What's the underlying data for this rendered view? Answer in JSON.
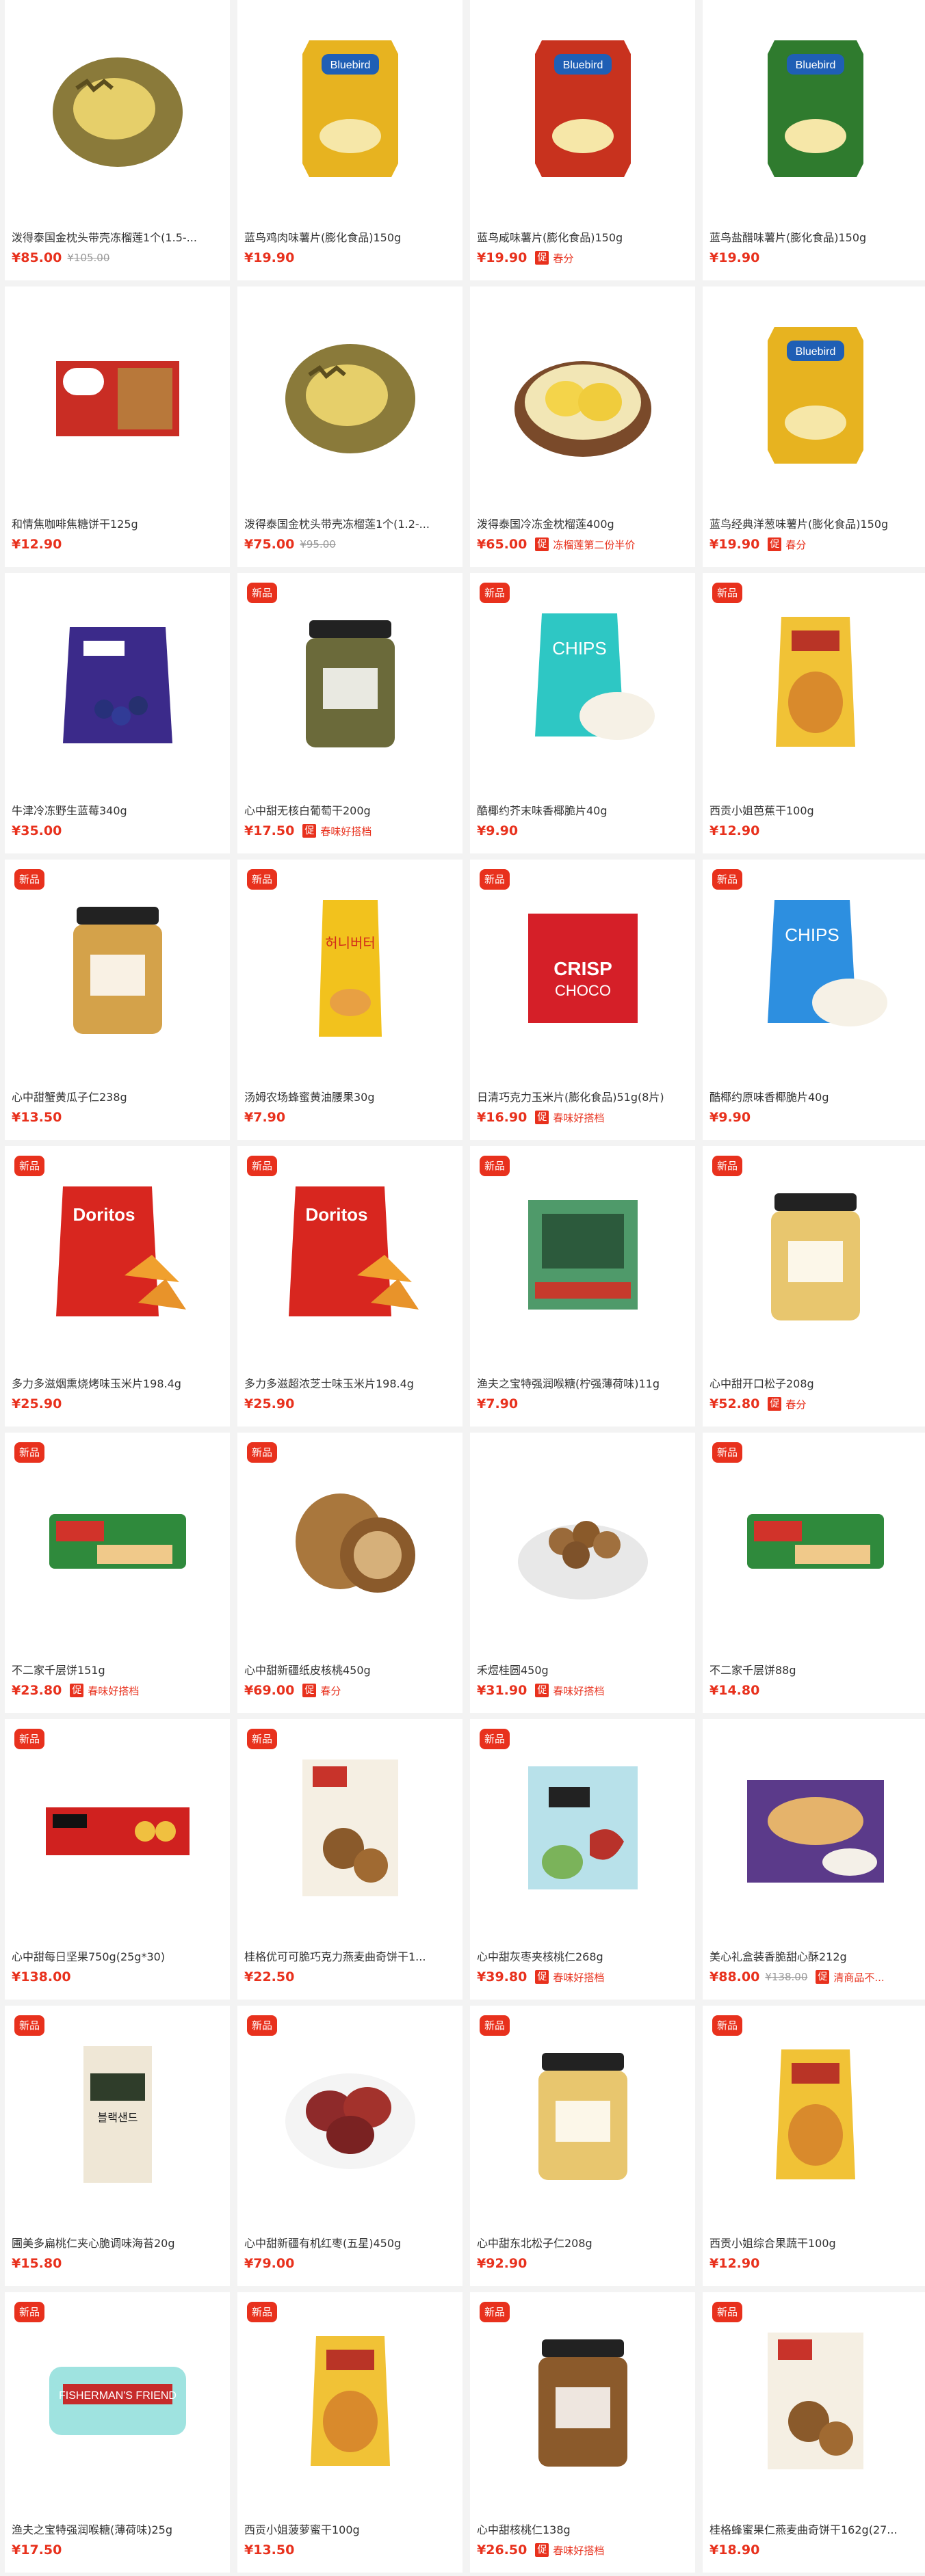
{
  "badge_text": "新品",
  "promo_tag_text": "促",
  "products": [
    {
      "name": "泼得泰国金枕头带壳冻榴莲1个(1.5-...",
      "price": "¥85.00",
      "original_price": "¥105.00",
      "is_new": false,
      "promo": "",
      "icon": "durian-whole-icon"
    },
    {
      "name": "蓝鸟鸡肉味薯片(膨化食品)150g",
      "price": "¥19.90",
      "original_price": "",
      "is_new": false,
      "promo": "",
      "icon": "chips-bag-yellow-icon"
    },
    {
      "name": "蓝鸟咸味薯片(膨化食品)150g",
      "price": "¥19.90",
      "original_price": "",
      "is_new": false,
      "promo": "春分",
      "icon": "chips-bag-red-icon"
    },
    {
      "name": "蓝鸟盐醋味薯片(膨化食品)150g",
      "price": "¥19.90",
      "original_price": "",
      "is_new": false,
      "promo": "",
      "icon": "chips-bag-green-icon"
    },
    {
      "name": "和情焦咖啡焦糖饼干125g",
      "price": "¥12.90",
      "original_price": "",
      "is_new": false,
      "promo": "",
      "icon": "biscuit-pack-icon"
    },
    {
      "name": "泼得泰国金枕头带壳冻榴莲1个(1.2-...",
      "price": "¥75.00",
      "original_price": "¥95.00",
      "is_new": false,
      "promo": "",
      "icon": "durian-whole-icon"
    },
    {
      "name": "泼得泰国冷冻金枕榴莲400g",
      "price": "¥65.00",
      "original_price": "",
      "is_new": false,
      "promo": "冻榴莲第二份半价",
      "icon": "durian-flesh-bowl-icon"
    },
    {
      "name": "蓝鸟经典洋葱味薯片(膨化食品)150g",
      "price": "¥19.90",
      "original_price": "",
      "is_new": false,
      "promo": "春分",
      "icon": "chips-bag-yellow-icon"
    },
    {
      "name": "牛津冷冻野生蓝莓340g",
      "price": "¥35.00",
      "original_price": "",
      "is_new": false,
      "promo": "",
      "icon": "blueberry-bag-icon"
    },
    {
      "name": "心中甜无核白葡萄干200g",
      "price": "¥17.50",
      "original_price": "",
      "is_new": true,
      "promo": "春味好搭档",
      "icon": "jar-raisin-icon"
    },
    {
      "name": "酷椰约芥末味香椰脆片40g",
      "price": "¥9.90",
      "original_price": "",
      "is_new": true,
      "promo": "",
      "icon": "coconut-chips-green-icon"
    },
    {
      "name": "西贡小姐芭蕉干100g",
      "price": "¥12.90",
      "original_price": "",
      "is_new": true,
      "promo": "",
      "icon": "banana-dried-bag-icon"
    },
    {
      "name": "心中甜蟹黄瓜子仁238g",
      "price": "¥13.50",
      "original_price": "",
      "is_new": true,
      "promo": "",
      "icon": "jar-seed-icon"
    },
    {
      "name": "汤姆农场蜂蜜黄油腰果30g",
      "price": "¥7.90",
      "original_price": "",
      "is_new": true,
      "promo": "",
      "icon": "cashew-bag-icon"
    },
    {
      "name": "日清巧克力玉米片(膨化食品)51g(8片)",
      "price": "¥16.90",
      "original_price": "",
      "is_new": true,
      "promo": "春味好搭档",
      "icon": "choco-box-icon"
    },
    {
      "name": "酷椰约原味香椰脆片40g",
      "price": "¥9.90",
      "original_price": "",
      "is_new": true,
      "promo": "",
      "icon": "coconut-chips-blue-icon"
    },
    {
      "name": "多力多滋烟熏烧烤味玉米片198.4g",
      "price": "¥25.90",
      "original_price": "",
      "is_new": true,
      "promo": "",
      "icon": "doritos-bag-icon"
    },
    {
      "name": "多力多滋超浓芝士味玉米片198.4g",
      "price": "¥25.90",
      "original_price": "",
      "is_new": true,
      "promo": "",
      "icon": "doritos-bag-icon"
    },
    {
      "name": "渔夫之宝特强润喉糖(柠强薄荷味)11g",
      "price": "¥7.90",
      "original_price": "",
      "is_new": true,
      "promo": "",
      "icon": "mint-pack-green-icon"
    },
    {
      "name": "心中甜开口松子208g",
      "price": "¥52.80",
      "original_price": "",
      "is_new": true,
      "promo": "春分",
      "icon": "jar-pinenut-icon"
    },
    {
      "name": "不二家千层饼151g",
      "price": "¥23.80",
      "original_price": "",
      "is_new": true,
      "promo": "春味好搭档",
      "icon": "pie-pack-icon"
    },
    {
      "name": "心中甜新疆纸皮核桃450g",
      "price": "¥69.00",
      "original_price": "",
      "is_new": true,
      "promo": "春分",
      "icon": "walnut-icon"
    },
    {
      "name": "禾煜桂圆450g",
      "price": "¥31.90",
      "original_price": "",
      "is_new": false,
      "promo": "春味好搭档",
      "icon": "longan-bowl-icon"
    },
    {
      "name": "不二家千层饼88g",
      "price": "¥14.80",
      "original_price": "",
      "is_new": true,
      "promo": "",
      "icon": "pie-pack-icon"
    },
    {
      "name": "心中甜每日坚果750g(25g*30)",
      "price": "¥138.00",
      "original_price": "",
      "is_new": true,
      "promo": "",
      "icon": "nut-box-red-icon"
    },
    {
      "name": "桂格优可可脆巧克力燕麦曲奇饼干1...",
      "price": "¥22.50",
      "original_price": "",
      "is_new": true,
      "promo": "",
      "icon": "cookie-box-icon"
    },
    {
      "name": "心中甜灰枣夹核桃仁268g",
      "price": "¥39.80",
      "original_price": "",
      "is_new": true,
      "promo": "春味好搭档",
      "icon": "date-walnut-bag-icon"
    },
    {
      "name": "美心礼盒装香脆甜心酥212g",
      "price": "¥88.00",
      "original_price": "¥138.00",
      "is_new": false,
      "promo": "清商品不...",
      "icon": "palmier-box-icon"
    },
    {
      "name": "圃美多扁桃仁夹心脆调味海苔20g",
      "price": "¥15.80",
      "original_price": "",
      "is_new": true,
      "promo": "",
      "icon": "seaweed-pack-icon"
    },
    {
      "name": "心中甜新疆有机红枣(五星)450g",
      "price": "¥79.00",
      "original_price": "",
      "is_new": true,
      "promo": "",
      "icon": "red-date-bowl-icon"
    },
    {
      "name": "心中甜东北松子仁208g",
      "price": "¥92.90",
      "original_price": "",
      "is_new": true,
      "promo": "",
      "icon": "jar-pinenut-kernel-icon"
    },
    {
      "name": "西贡小姐综合果蔬干100g",
      "price": "¥12.90",
      "original_price": "",
      "is_new": true,
      "promo": "",
      "icon": "mixed-fruit-bag-icon"
    },
    {
      "name": "渔夫之宝特强润喉糖(薄荷味)25g",
      "price": "¥17.50",
      "original_price": "",
      "is_new": true,
      "promo": "",
      "icon": "mint-tin-icon"
    },
    {
      "name": "西贡小姐菠萝蜜干100g",
      "price": "¥13.50",
      "original_price": "",
      "is_new": true,
      "promo": "",
      "icon": "jackfruit-bag-icon"
    },
    {
      "name": "心中甜核桃仁138g",
      "price": "¥26.50",
      "original_price": "",
      "is_new": true,
      "promo": "春味好搭档",
      "icon": "jar-walnut-icon"
    },
    {
      "name": "桂格蜂蜜果仁燕麦曲奇饼干162g(27...",
      "price": "¥18.90",
      "original_price": "",
      "is_new": true,
      "promo": "",
      "icon": "cookie-box-honey-icon"
    }
  ],
  "colors": {
    "accent": "#e8311d",
    "page_bg": "#f3f3f3",
    "card_bg": "#ffffff"
  }
}
